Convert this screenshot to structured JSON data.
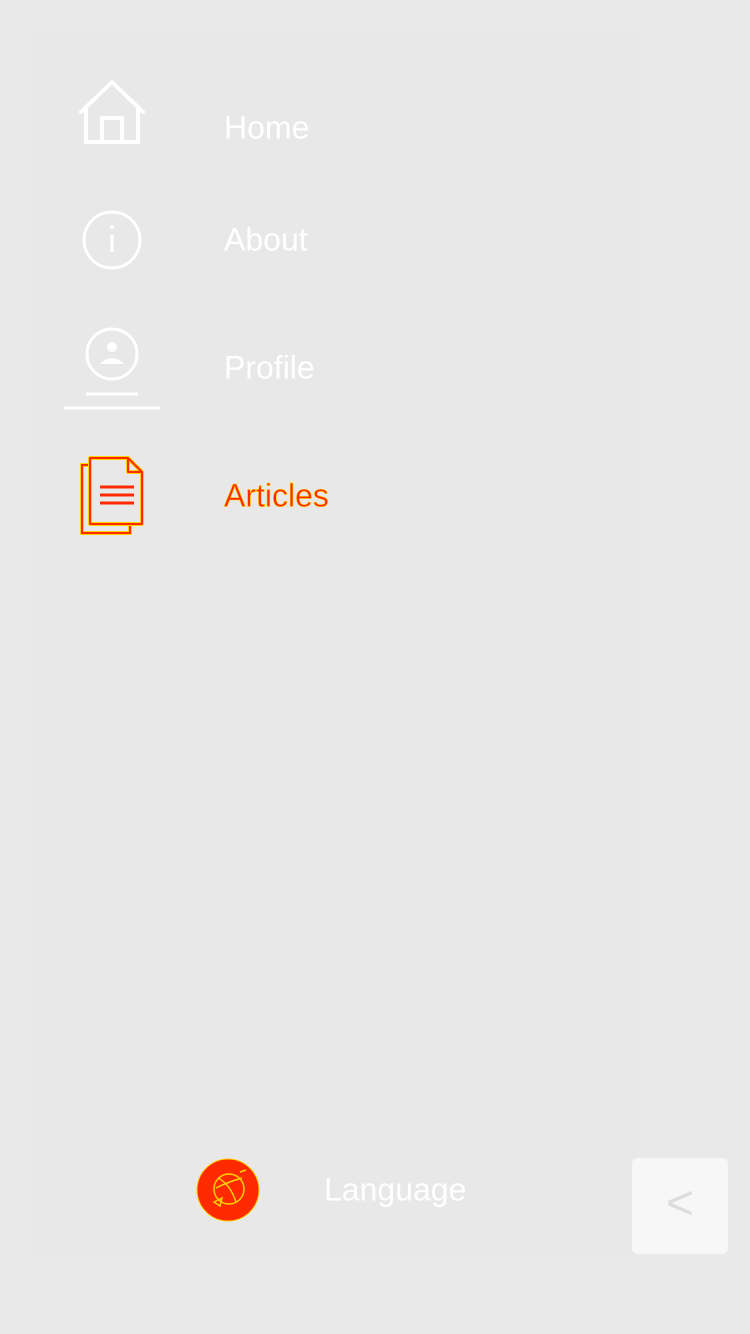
{
  "drawer": {
    "items": [
      {
        "label": "Home",
        "icon": "home-icon",
        "active": false
      },
      {
        "label": "About",
        "icon": "info-icon",
        "active": false
      },
      {
        "label": "Profile",
        "icon": "profile-icon",
        "active": false
      },
      {
        "label": "Articles",
        "icon": "articles-icon",
        "active": true
      }
    ],
    "language": {
      "label": "Language",
      "icon": "language-icon"
    }
  },
  "back_button": {
    "glyph": "<",
    "icon": "chevron-left-icon"
  },
  "colors": {
    "background": "#e9e9e9",
    "inactive_text": "#ffffff",
    "active_text": "#ff2a00",
    "active_outline": "#ffd200",
    "button_bg": "#f7f7f7"
  }
}
